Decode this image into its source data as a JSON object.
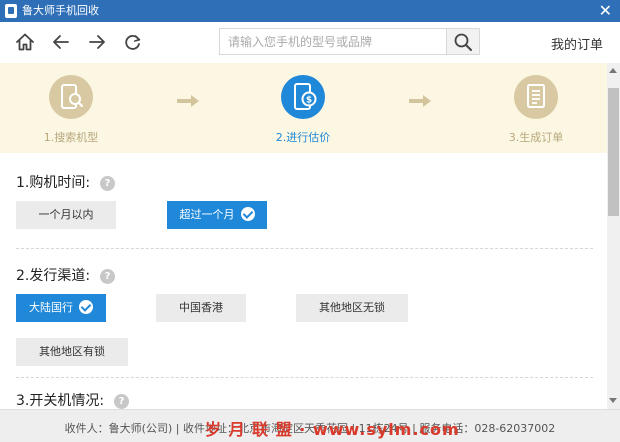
{
  "window": {
    "title": "鲁大师手机回收",
    "close_glyph": "✕"
  },
  "toolbar": {
    "search_placeholder": "请输入您手机的型号或品牌",
    "my_orders": "我的订单"
  },
  "steps": [
    {
      "label": "1.搜索机型",
      "state": "done"
    },
    {
      "label": "2.进行估价",
      "state": "active"
    },
    {
      "label": "3.生成订单",
      "state": "pending"
    }
  ],
  "colors": {
    "accent": "#1f88d8",
    "title_bar": "#2f6fb8",
    "step_inactive": "#d8c9a2",
    "step_bg": "#fcf7e2"
  },
  "questions": [
    {
      "title": "1.购机时间:",
      "options": [
        {
          "label": "一个月以内",
          "selected": false
        },
        {
          "label": "超过一个月",
          "selected": true
        }
      ]
    },
    {
      "title": "2.发行渠道:",
      "options": [
        {
          "label": "大陆国行",
          "selected": true
        },
        {
          "label": "中国香港",
          "selected": false
        },
        {
          "label": "其他地区无锁",
          "selected": false
        },
        {
          "label": "其他地区有锁",
          "selected": false
        }
      ]
    },
    {
      "title": "3.开关机情况:",
      "options": []
    }
  ],
  "help_glyph": "?",
  "footer": {
    "text": "收件人：鲁大师(公司) | 收件地址：北京市海淀区天秀花园 | 11栋24号 | 服务电话：028-62037002"
  },
  "watermark": "岁 月 联 盟 · www.sylm.com"
}
